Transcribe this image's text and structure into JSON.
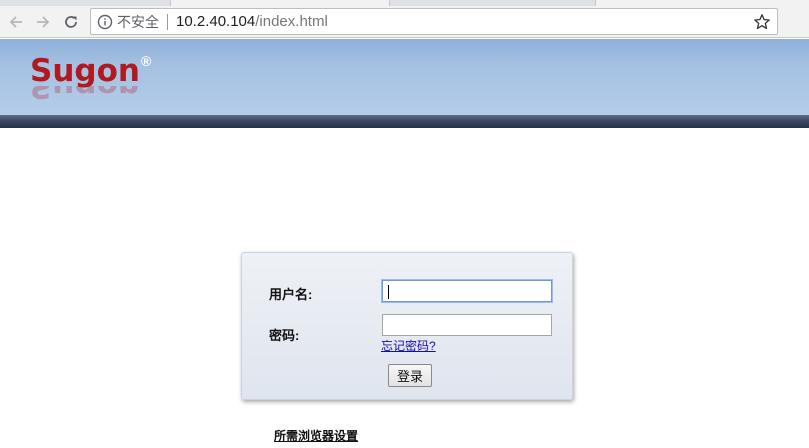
{
  "browser": {
    "security_text": "不安全",
    "url_host": "10.2.40.104",
    "url_path": "/index.html"
  },
  "header": {
    "logo_text": "Sugon",
    "logo_registered": "®",
    "brand_color": "#b0191e"
  },
  "login": {
    "username_label": "用户名:",
    "username_value": "",
    "password_label": "密码:",
    "password_value": "",
    "forgot_password": "忘记密码?",
    "submit_label": "登录"
  },
  "footer": {
    "browser_settings": "所需浏览器设置"
  },
  "icons": {
    "back": "arrow-left-icon",
    "forward": "arrow-right-icon",
    "reload": "reload-icon",
    "info": "info-icon",
    "bookmark": "star-icon"
  }
}
